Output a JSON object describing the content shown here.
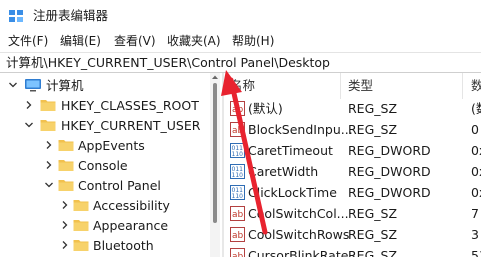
{
  "window": {
    "title": "注册表编辑器",
    "icon": "regedit-icon"
  },
  "menu": [
    "文件(F)",
    "编辑(E)",
    "查看(V)",
    "收藏夹(A)",
    "帮助(H)"
  ],
  "address": {
    "path": "计算机\\HKEY_CURRENT_USER\\Control Panel\\Desktop"
  },
  "tree": {
    "root": "计算机",
    "items": [
      {
        "label": "HKEY_CLASSES_ROOT",
        "expanded": false
      },
      {
        "label": "HKEY_CURRENT_USER",
        "expanded": true
      },
      {
        "label": "AppEvents",
        "expanded": false
      },
      {
        "label": "Console",
        "expanded": false
      },
      {
        "label": "Control Panel",
        "expanded": true
      },
      {
        "label": "Accessibility",
        "expanded": false
      },
      {
        "label": "Appearance",
        "expanded": false
      },
      {
        "label": "Bluetooth",
        "expanded": false
      }
    ]
  },
  "list": {
    "headers": {
      "name": "名称",
      "type": "类型",
      "data": "数"
    },
    "rows": [
      {
        "name": "(默认)",
        "type": "REG_SZ",
        "data": "(数",
        "icon": "string-value-icon"
      },
      {
        "name": "BlockSendInpu...",
        "type": "REG_SZ",
        "data": "0",
        "icon": "string-value-icon"
      },
      {
        "name": "CaretTimeout",
        "type": "REG_DWORD",
        "data": "0x",
        "icon": "dword-value-icon"
      },
      {
        "name": "CaretWidth",
        "type": "REG_DWORD",
        "data": "0x",
        "icon": "dword-value-icon"
      },
      {
        "name": "ClickLockTime",
        "type": "REG_DWORD",
        "data": "0x",
        "icon": "dword-value-icon"
      },
      {
        "name": "CoolSwitchCol...",
        "type": "REG_SZ",
        "data": "7",
        "icon": "string-value-icon"
      },
      {
        "name": "CoolSwitchRows",
        "type": "REG_SZ",
        "data": "3",
        "icon": "string-value-icon"
      },
      {
        "name": "CursorBlinkRate",
        "type": "REG_SZ",
        "data": "53",
        "icon": "string-value-icon"
      }
    ]
  },
  "colors": {
    "annotation_arrow": "#e8232f",
    "folder": "#f2c14e",
    "computer": "#2f7dd1"
  }
}
